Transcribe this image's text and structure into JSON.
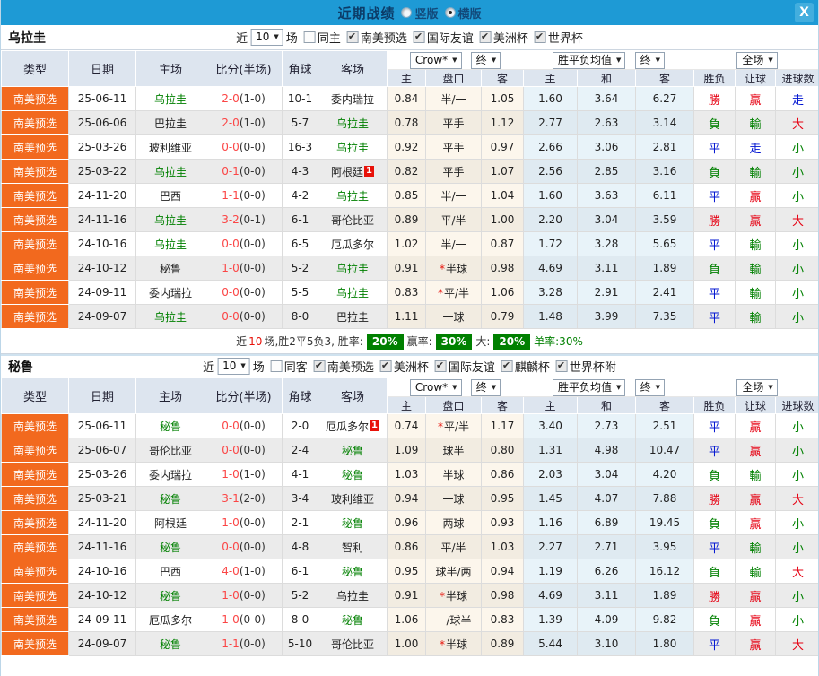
{
  "titlebar": {
    "title": "近期战绩",
    "layout_options": [
      {
        "label": "竖版",
        "selected": false
      },
      {
        "label": "横版",
        "selected": true
      }
    ],
    "close_label": "X"
  },
  "table_headers": {
    "type": "类型",
    "date": "日期",
    "home": "主场",
    "score": "比分(半场)",
    "corner": "角球",
    "away": "客场",
    "company_select": "Crow*",
    "final_select1": "终",
    "europe_select": "胜平负均值",
    "final_select2": "终",
    "scope_select": "全场",
    "asian_home": "主",
    "asian_handicap": "盘口",
    "asian_away": "客",
    "euro_home": "主",
    "euro_draw": "和",
    "euro_away": "客",
    "result_wdl": "胜负",
    "result_handicap": "让球",
    "result_goals": "进球数"
  },
  "colors": {
    "topbar_blue": "#1e9ad5",
    "type_orange": "#f2691e",
    "win_red": "#e60012",
    "lose_green": "#008000",
    "draw_blue": "#0014d2",
    "team_green": "#008000",
    "score_red": "#fb4545",
    "badge_red": "#e8120a",
    "rate_badge_green": "#008000",
    "header_bg": "#dde5ef"
  },
  "sections": [
    {
      "team": "乌拉圭",
      "filter": {
        "near": "近",
        "count": "10",
        "games": "场",
        "same": "同主",
        "same_checked": false,
        "competitions": [
          {
            "label": "南美预选",
            "checked": true
          },
          {
            "label": "国际友谊",
            "checked": true
          },
          {
            "label": "美洲杯",
            "checked": true
          },
          {
            "label": "世界杯",
            "checked": true
          }
        ]
      },
      "rows": [
        {
          "type": "南美预选",
          "date": "25-06-11",
          "home": "乌拉圭",
          "home_focus": true,
          "score": "2-0",
          "half": "(1-0)",
          "corner": "10-1",
          "away": "委内瑞拉",
          "away_focus": false,
          "away_badge": "",
          "ah": "0.84",
          "hcap": "半/一",
          "hcap_star": false,
          "aa": "1.05",
          "eh": "1.60",
          "ed": "3.64",
          "ea": "6.27",
          "r1": "勝",
          "r1c": "red",
          "r2": "贏",
          "r2c": "red",
          "r3": "走",
          "r3c": "blue"
        },
        {
          "type": "南美预选",
          "date": "25-06-06",
          "home": "巴拉圭",
          "home_focus": false,
          "score": "2-0",
          "half": "(1-0)",
          "corner": "5-7",
          "away": "乌拉圭",
          "away_focus": true,
          "away_badge": "",
          "ah": "0.78",
          "hcap": "平手",
          "hcap_star": false,
          "aa": "1.12",
          "eh": "2.77",
          "ed": "2.63",
          "ea": "3.14",
          "r1": "負",
          "r1c": "green",
          "r2": "輸",
          "r2c": "green",
          "r3": "大",
          "r3c": "red"
        },
        {
          "type": "南美预选",
          "date": "25-03-26",
          "home": "玻利维亚",
          "home_focus": false,
          "score": "0-0",
          "half": "(0-0)",
          "corner": "16-3",
          "away": "乌拉圭",
          "away_focus": true,
          "away_badge": "",
          "ah": "0.92",
          "hcap": "平手",
          "hcap_star": false,
          "aa": "0.97",
          "eh": "2.66",
          "ed": "3.06",
          "ea": "2.81",
          "r1": "平",
          "r1c": "blue",
          "r2": "走",
          "r2c": "blue",
          "r3": "小",
          "r3c": "green"
        },
        {
          "type": "南美预选",
          "date": "25-03-22",
          "home": "乌拉圭",
          "home_focus": true,
          "score": "0-1",
          "half": "(0-0)",
          "corner": "4-3",
          "away": "阿根廷",
          "away_focus": false,
          "away_badge": "1",
          "ah": "0.82",
          "hcap": "平手",
          "hcap_star": false,
          "aa": "1.07",
          "eh": "2.56",
          "ed": "2.85",
          "ea": "3.16",
          "r1": "負",
          "r1c": "green",
          "r2": "輸",
          "r2c": "green",
          "r3": "小",
          "r3c": "green"
        },
        {
          "type": "南美预选",
          "date": "24-11-20",
          "home": "巴西",
          "home_focus": false,
          "score": "1-1",
          "half": "(0-0)",
          "corner": "4-2",
          "away": "乌拉圭",
          "away_focus": true,
          "away_badge": "",
          "ah": "0.85",
          "hcap": "半/一",
          "hcap_star": false,
          "aa": "1.04",
          "eh": "1.60",
          "ed": "3.63",
          "ea": "6.11",
          "r1": "平",
          "r1c": "blue",
          "r2": "贏",
          "r2c": "red",
          "r3": "小",
          "r3c": "green"
        },
        {
          "type": "南美预选",
          "date": "24-11-16",
          "home": "乌拉圭",
          "home_focus": true,
          "score": "3-2",
          "half": "(0-1)",
          "corner": "6-1",
          "away": "哥伦比亚",
          "away_focus": false,
          "away_badge": "",
          "ah": "0.89",
          "hcap": "平/半",
          "hcap_star": false,
          "aa": "1.00",
          "eh": "2.20",
          "ed": "3.04",
          "ea": "3.59",
          "r1": "勝",
          "r1c": "red",
          "r2": "贏",
          "r2c": "red",
          "r3": "大",
          "r3c": "red"
        },
        {
          "type": "南美预选",
          "date": "24-10-16",
          "home": "乌拉圭",
          "home_focus": true,
          "score": "0-0",
          "half": "(0-0)",
          "corner": "6-5",
          "away": "厄瓜多尔",
          "away_focus": false,
          "away_badge": "",
          "ah": "1.02",
          "hcap": "半/一",
          "hcap_star": false,
          "aa": "0.87",
          "eh": "1.72",
          "ed": "3.28",
          "ea": "5.65",
          "r1": "平",
          "r1c": "blue",
          "r2": "輸",
          "r2c": "green",
          "r3": "小",
          "r3c": "green"
        },
        {
          "type": "南美预选",
          "date": "24-10-12",
          "home": "秘鲁",
          "home_focus": false,
          "score": "1-0",
          "half": "(0-0)",
          "corner": "5-2",
          "away": "乌拉圭",
          "away_focus": true,
          "away_badge": "",
          "ah": "0.91",
          "hcap": "半球",
          "hcap_star": true,
          "aa": "0.98",
          "eh": "4.69",
          "ed": "3.11",
          "ea": "1.89",
          "r1": "負",
          "r1c": "green",
          "r2": "輸",
          "r2c": "green",
          "r3": "小",
          "r3c": "green"
        },
        {
          "type": "南美预选",
          "date": "24-09-11",
          "home": "委内瑞拉",
          "home_focus": false,
          "score": "0-0",
          "half": "(0-0)",
          "corner": "5-5",
          "away": "乌拉圭",
          "away_focus": true,
          "away_badge": "",
          "ah": "0.83",
          "hcap": "平/半",
          "hcap_star": true,
          "aa": "1.06",
          "eh": "3.28",
          "ed": "2.91",
          "ea": "2.41",
          "r1": "平",
          "r1c": "blue",
          "r2": "輸",
          "r2c": "green",
          "r3": "小",
          "r3c": "green"
        },
        {
          "type": "南美预选",
          "date": "24-09-07",
          "home": "乌拉圭",
          "home_focus": true,
          "score": "0-0",
          "half": "(0-0)",
          "corner": "8-0",
          "away": "巴拉圭",
          "away_focus": false,
          "away_badge": "",
          "ah": "1.11",
          "hcap": "一球",
          "hcap_star": false,
          "aa": "0.79",
          "eh": "1.48",
          "ed": "3.99",
          "ea": "7.35",
          "r1": "平",
          "r1c": "blue",
          "r2": "輸",
          "r2c": "green",
          "r3": "小",
          "r3c": "green"
        }
      ],
      "summary": {
        "near": "近",
        "count": "10",
        "mid": "场,胜2平5负3, 胜率:",
        "win_rate": "20%",
        "label2": "赢率:",
        "rate2": "30%",
        "label3": "大:",
        "rate3": "20%",
        "label4": "单率:",
        "rate4": "30%"
      }
    },
    {
      "team": "秘鲁",
      "filter": {
        "near": "近",
        "count": "10",
        "games": "场",
        "same": "同客",
        "same_checked": false,
        "competitions": [
          {
            "label": "南美预选",
            "checked": true
          },
          {
            "label": "美洲杯",
            "checked": true
          },
          {
            "label": "国际友谊",
            "checked": true
          },
          {
            "label": "麒麟杯",
            "checked": true
          },
          {
            "label": "世界杯附",
            "checked": true
          }
        ]
      },
      "rows": [
        {
          "type": "南美预选",
          "date": "25-06-11",
          "home": "秘鲁",
          "home_focus": true,
          "score": "0-0",
          "half": "(0-0)",
          "corner": "2-0",
          "away": "厄瓜多尔",
          "away_focus": false,
          "away_badge": "1",
          "ah": "0.74",
          "hcap": "平/半",
          "hcap_star": true,
          "aa": "1.17",
          "eh": "3.40",
          "ed": "2.73",
          "ea": "2.51",
          "r1": "平",
          "r1c": "blue",
          "r2": "贏",
          "r2c": "red",
          "r3": "小",
          "r3c": "green"
        },
        {
          "type": "南美预选",
          "date": "25-06-07",
          "home": "哥伦比亚",
          "home_focus": false,
          "score": "0-0",
          "half": "(0-0)",
          "corner": "2-4",
          "away": "秘鲁",
          "away_focus": true,
          "away_badge": "",
          "ah": "1.09",
          "hcap": "球半",
          "hcap_star": false,
          "aa": "0.80",
          "eh": "1.31",
          "ed": "4.98",
          "ea": "10.47",
          "r1": "平",
          "r1c": "blue",
          "r2": "贏",
          "r2c": "red",
          "r3": "小",
          "r3c": "green"
        },
        {
          "type": "南美预选",
          "date": "25-03-26",
          "home": "委内瑞拉",
          "home_focus": false,
          "score": "1-0",
          "half": "(1-0)",
          "corner": "4-1",
          "away": "秘鲁",
          "away_focus": true,
          "away_badge": "",
          "ah": "1.03",
          "hcap": "半球",
          "hcap_star": false,
          "aa": "0.86",
          "eh": "2.03",
          "ed": "3.04",
          "ea": "4.20",
          "r1": "負",
          "r1c": "green",
          "r2": "輸",
          "r2c": "green",
          "r3": "小",
          "r3c": "green"
        },
        {
          "type": "南美预选",
          "date": "25-03-21",
          "home": "秘鲁",
          "home_focus": true,
          "score": "3-1",
          "half": "(2-0)",
          "corner": "3-4",
          "away": "玻利维亚",
          "away_focus": false,
          "away_badge": "",
          "ah": "0.94",
          "hcap": "一球",
          "hcap_star": false,
          "aa": "0.95",
          "eh": "1.45",
          "ed": "4.07",
          "ea": "7.88",
          "r1": "勝",
          "r1c": "red",
          "r2": "贏",
          "r2c": "red",
          "r3": "大",
          "r3c": "red"
        },
        {
          "type": "南美预选",
          "date": "24-11-20",
          "home": "阿根廷",
          "home_focus": false,
          "score": "1-0",
          "half": "(0-0)",
          "corner": "2-1",
          "away": "秘鲁",
          "away_focus": true,
          "away_badge": "",
          "ah": "0.96",
          "hcap": "两球",
          "hcap_star": false,
          "aa": "0.93",
          "eh": "1.16",
          "ed": "6.89",
          "ea": "19.45",
          "r1": "負",
          "r1c": "green",
          "r2": "贏",
          "r2c": "red",
          "r3": "小",
          "r3c": "green"
        },
        {
          "type": "南美预选",
          "date": "24-11-16",
          "home": "秘鲁",
          "home_focus": true,
          "score": "0-0",
          "half": "(0-0)",
          "corner": "4-8",
          "away": "智利",
          "away_focus": false,
          "away_badge": "",
          "ah": "0.86",
          "hcap": "平/半",
          "hcap_star": false,
          "aa": "1.03",
          "eh": "2.27",
          "ed": "2.71",
          "ea": "3.95",
          "r1": "平",
          "r1c": "blue",
          "r2": "輸",
          "r2c": "green",
          "r3": "小",
          "r3c": "green"
        },
        {
          "type": "南美预选",
          "date": "24-10-16",
          "home": "巴西",
          "home_focus": false,
          "score": "4-0",
          "half": "(1-0)",
          "corner": "6-1",
          "away": "秘鲁",
          "away_focus": true,
          "away_badge": "",
          "ah": "0.95",
          "hcap": "球半/两",
          "hcap_star": false,
          "aa": "0.94",
          "eh": "1.19",
          "ed": "6.26",
          "ea": "16.12",
          "r1": "負",
          "r1c": "green",
          "r2": "輸",
          "r2c": "green",
          "r3": "大",
          "r3c": "red"
        },
        {
          "type": "南美预选",
          "date": "24-10-12",
          "home": "秘鲁",
          "home_focus": true,
          "score": "1-0",
          "half": "(0-0)",
          "corner": "5-2",
          "away": "乌拉圭",
          "away_focus": false,
          "away_badge": "",
          "ah": "0.91",
          "hcap": "半球",
          "hcap_star": true,
          "aa": "0.98",
          "eh": "4.69",
          "ed": "3.11",
          "ea": "1.89",
          "r1": "勝",
          "r1c": "red",
          "r2": "贏",
          "r2c": "red",
          "r3": "小",
          "r3c": "green"
        },
        {
          "type": "南美预选",
          "date": "24-09-11",
          "home": "厄瓜多尔",
          "home_focus": false,
          "score": "1-0",
          "half": "(0-0)",
          "corner": "8-0",
          "away": "秘鲁",
          "away_focus": true,
          "away_badge": "",
          "ah": "1.06",
          "hcap": "一/球半",
          "hcap_star": false,
          "aa": "0.83",
          "eh": "1.39",
          "ed": "4.09",
          "ea": "9.82",
          "r1": "負",
          "r1c": "green",
          "r2": "贏",
          "r2c": "red",
          "r3": "小",
          "r3c": "green"
        },
        {
          "type": "南美预选",
          "date": "24-09-07",
          "home": "秘鲁",
          "home_focus": true,
          "score": "1-1",
          "half": "(0-0)",
          "corner": "5-10",
          "away": "哥伦比亚",
          "away_focus": false,
          "away_badge": "",
          "ah": "1.00",
          "hcap": "半球",
          "hcap_star": true,
          "aa": "0.89",
          "eh": "5.44",
          "ed": "3.10",
          "ea": "1.80",
          "r1": "平",
          "r1c": "blue",
          "r2": "贏",
          "r2c": "red",
          "r3": "大",
          "r3c": "red"
        }
      ],
      "summary": null
    }
  ]
}
